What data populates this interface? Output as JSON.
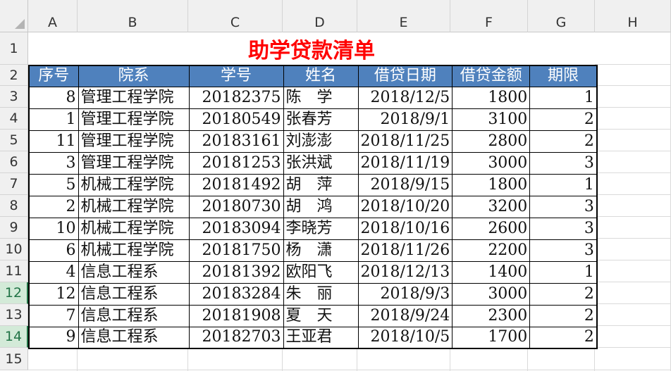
{
  "sheet": {
    "columns": [
      "A",
      "B",
      "C",
      "D",
      "E",
      "F",
      "G",
      "H"
    ],
    "rows": [
      "1",
      "2",
      "3",
      "4",
      "5",
      "6",
      "7",
      "8",
      "9",
      "10",
      "11",
      "12",
      "13",
      "14",
      "15"
    ],
    "selected_rows": [
      "12",
      "14"
    ]
  },
  "table": {
    "title": "助学贷款清单",
    "headers": [
      "序号",
      "院系",
      "学号",
      "姓名",
      "借贷日期",
      "借贷金额",
      "期限"
    ],
    "records": [
      [
        "8",
        "管理工程学院",
        "20182375",
        "陈　学",
        "2018/12/5",
        "1800",
        "1"
      ],
      [
        "1",
        "管理工程学院",
        "20180549",
        "张春芳",
        "2018/9/1",
        "3100",
        "2"
      ],
      [
        "11",
        "管理工程学院",
        "20183161",
        "刘澎澎",
        "2018/11/25",
        "2800",
        "2"
      ],
      [
        "3",
        "管理工程学院",
        "20181253",
        "张洪斌",
        "2018/11/19",
        "3000",
        "3"
      ],
      [
        "5",
        "机械工程学院",
        "20181492",
        "胡　萍",
        "2018/9/15",
        "1800",
        "1"
      ],
      [
        "2",
        "机械工程学院",
        "20180730",
        "胡　鸿",
        "2018/10/20",
        "3200",
        "3"
      ],
      [
        "10",
        "机械工程学院",
        "20183094",
        "李晓芳",
        "2018/10/16",
        "2600",
        "3"
      ],
      [
        "6",
        "机械工程学院",
        "20181750",
        "杨　潇",
        "2018/11/26",
        "2200",
        "3"
      ],
      [
        "4",
        "信息工程系",
        "20181392",
        "欧阳飞",
        "2018/12/13",
        "1400",
        "1"
      ],
      [
        "12",
        "信息工程系",
        "20183284",
        "朱　丽",
        "2018/9/3",
        "3000",
        "2"
      ],
      [
        "7",
        "信息工程系",
        "20181908",
        "夏　天",
        "2018/9/24",
        "2300",
        "2"
      ],
      [
        "9",
        "信息工程系",
        "20182703",
        "王亚君",
        "2018/10/5",
        "1700",
        "2"
      ]
    ]
  },
  "colors": {
    "header_fill": "#4f81bd",
    "title_color": "#ff0000",
    "selection": "#217346"
  }
}
